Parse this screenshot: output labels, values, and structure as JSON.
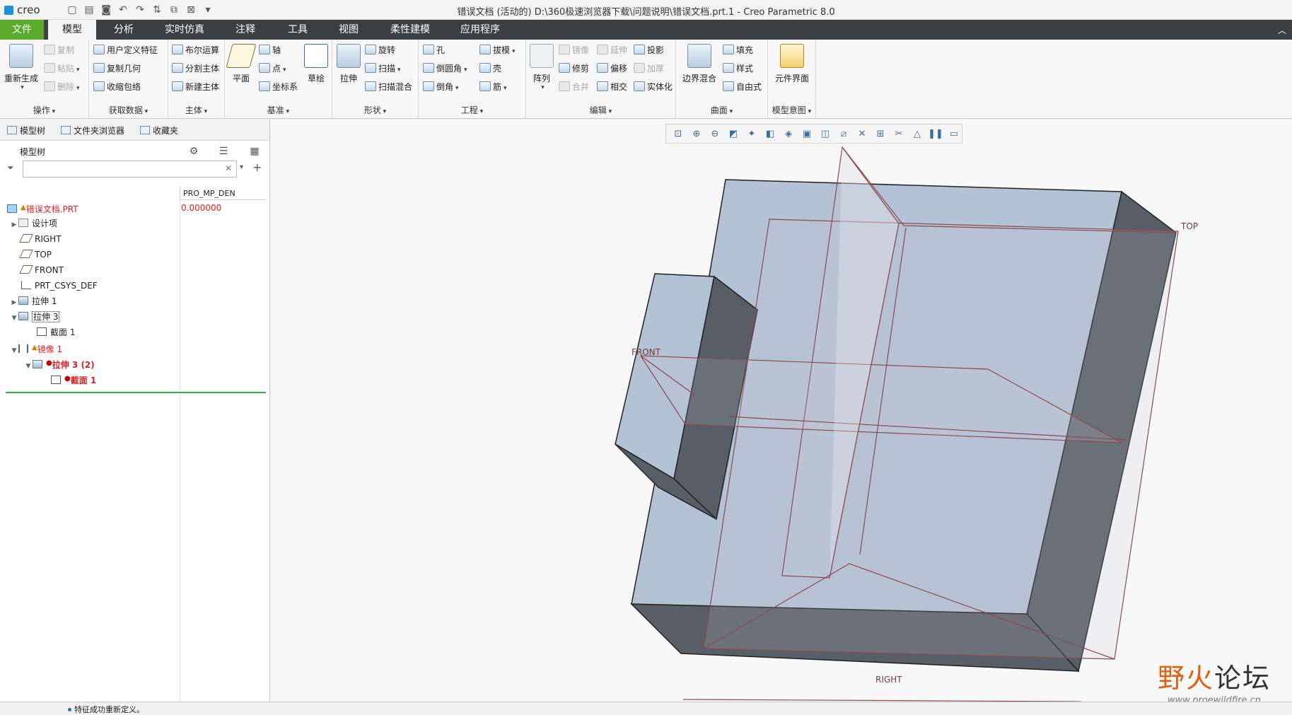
{
  "titlebar": {
    "logo": "creo",
    "title": "错误文档 (活动的) D:\\360极速浏览器下载\\问题说明\\错误文档.prt.1 - Creo Parametric 8.0"
  },
  "tabs": [
    "文件",
    "模型",
    "分析",
    "实时仿真",
    "注释",
    "工具",
    "视图",
    "柔性建模",
    "应用程序"
  ],
  "ribbon": {
    "ops": {
      "regen": "重新生成",
      "copy": "复制",
      "paste": "粘贴",
      "delete": "删除",
      "label": "操作"
    },
    "getdata": {
      "udf": "用户定义特征",
      "copygeom": "复制几何",
      "shrinkwrap": "收缩包络",
      "label": "获取数据"
    },
    "body": {
      "boolean": "布尔运算",
      "split": "分割主体",
      "newbody": "新建主体",
      "label": "主体"
    },
    "datum": {
      "plane": "平面",
      "axis": "轴",
      "point": "点",
      "csys": "坐标系",
      "sketch": "草绘",
      "label": "基准"
    },
    "shapes": {
      "extrude": "拉伸",
      "revolve": "旋转",
      "sweep": "扫描",
      "sweptblend": "扫描混合",
      "label": "形状"
    },
    "eng": {
      "hole": "孔",
      "round": "倒圆角",
      "chamfer": "倒角",
      "draft": "拔模",
      "shell": "壳",
      "rib": "筋",
      "label": "工程"
    },
    "edit": {
      "pattern": "阵列",
      "mirror": "镜像",
      "extend": "延伸",
      "project": "投影",
      "trim": "修剪",
      "offset": "偏移",
      "thicken": "加厚",
      "merge": "合并",
      "intersect": "相交",
      "solidify": "实体化",
      "label": "编辑"
    },
    "surf": {
      "boundary": "边界混合",
      "fill": "填充",
      "style": "样式",
      "freestyle": "自由式",
      "label": "曲面"
    },
    "intent": {
      "compint": "元件界面",
      "label": "模型意图"
    }
  },
  "leftpanel": {
    "navtabs": [
      "模型树",
      "文件夹浏览器",
      "收藏夹"
    ],
    "tree_title": "模型树",
    "filter_placeholder": "",
    "column": "PRO_MP_DEN",
    "rows": [
      {
        "label": "错误文档.PRT",
        "value": "0.000000"
      },
      {
        "label": "设计项"
      },
      {
        "label": "RIGHT"
      },
      {
        "label": "TOP"
      },
      {
        "label": "FRONT"
      },
      {
        "label": "PRT_CSYS_DEF"
      },
      {
        "label": "拉伸 1"
      },
      {
        "label": "拉伸 3"
      },
      {
        "label": "截面 1"
      },
      {
        "label": "镜像 1"
      },
      {
        "label": "拉伸 3 (2)"
      },
      {
        "label": "截面 1"
      }
    ]
  },
  "graphics": {
    "labels": {
      "top": "TOP",
      "front": "FRONT",
      "right": "RIGHT"
    }
  },
  "status": {
    "message": "特征成功重新定义。"
  },
  "watermark": {
    "cn1": "野火",
    "cn2": "论坛",
    "url": "www.proewildfire.cn"
  },
  "colors": {
    "file_tab": "#5aaa2c",
    "tab_bar": "#3c4043",
    "error": "#e02020",
    "selection_line": "#31b24b"
  }
}
